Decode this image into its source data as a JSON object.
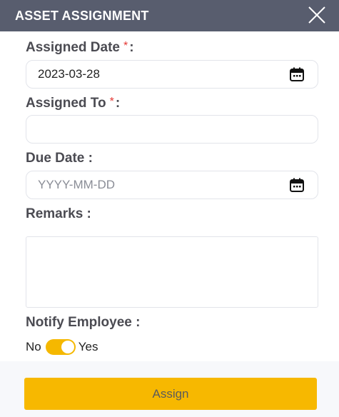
{
  "header": {
    "title": "ASSET ASSIGNMENT",
    "close_icon": "close-icon"
  },
  "form": {
    "assigned_date": {
      "label": "Assigned Date",
      "required_mark": "*",
      "colon": ":",
      "value": "2023-03-28",
      "icon": "calendar-icon"
    },
    "assigned_to": {
      "label": "Assigned To",
      "required_mark": "*",
      "colon": ":",
      "value": ""
    },
    "due_date": {
      "label": "Due Date :",
      "placeholder": "YYYY-MM-DD",
      "value": "",
      "icon": "calendar-icon"
    },
    "remarks": {
      "label": "Remarks :",
      "value": ""
    },
    "notify": {
      "label": "Notify Employee :",
      "off_label": "No",
      "on_label": "Yes",
      "enabled": true
    }
  },
  "footer": {
    "assign_label": "Assign"
  },
  "colors": {
    "header_bg": "#585d6e",
    "accent": "#f7b800",
    "required": "#e53935"
  }
}
